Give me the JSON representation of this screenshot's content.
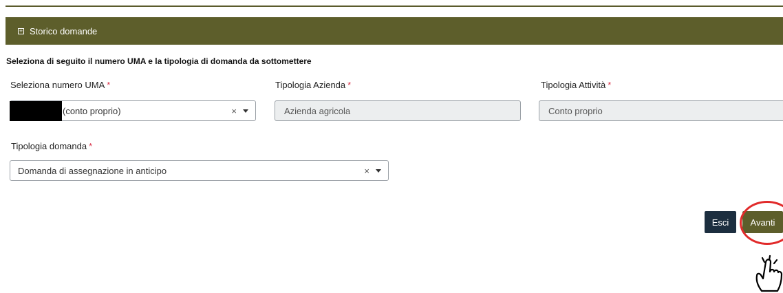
{
  "accordion": {
    "icon": "plus-square-icon",
    "label": "Storico domande"
  },
  "instruction": "Seleziona di seguito il numero UMA e la tipologia di domanda da sottomettere",
  "form": {
    "uma": {
      "label": "Seleziona numero UMA",
      "required_mark": "*",
      "value": "(conto proprio)"
    },
    "tipologia_azienda": {
      "label": "Tipologia Azienda",
      "required_mark": "*",
      "value": "Azienda agricola"
    },
    "tipologia_attivita": {
      "label": "Tipologia Attività",
      "required_mark": "*",
      "value": "Conto proprio"
    },
    "tipologia_domanda": {
      "label": "Tipologia domanda",
      "required_mark": "*",
      "value": "Domanda di assegnazione in anticipo"
    },
    "clear_glyph": "×"
  },
  "buttons": {
    "exit": "Esci",
    "next": "Avanti"
  },
  "annotation": {
    "highlight_color": "#e12a2a",
    "cursor": "hand-pointer-icon"
  }
}
